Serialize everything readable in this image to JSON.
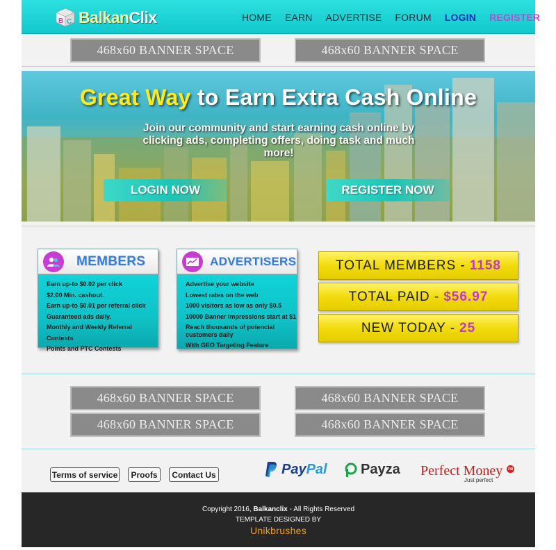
{
  "logo": {
    "part1": "Balkan",
    "part2": "Clix"
  },
  "nav": [
    {
      "label": "HOME"
    },
    {
      "label": "EARN"
    },
    {
      "label": "ADVERTISE"
    },
    {
      "label": "FORUM"
    },
    {
      "label": "LOGIN"
    },
    {
      "label": "REGISTER"
    }
  ],
  "banner_label": "468x60 BANNER SPACE",
  "hero": {
    "title_highlight": "Great Way",
    "title_rest": " to Earn Extra Cash Online",
    "subtitle": "Join our community and start earning cash online by clicking ads, completing offers, doing task and much more!",
    "login_button": "LOGIN NOW",
    "register_button": "REGISTER NOW"
  },
  "members_box": {
    "title": "MEMBERS",
    "items": [
      "Earn up-to $0.02 per click",
      "$2.00 Min. cashout.",
      "Earn up-to $0.01 per referral click",
      "Guaranteed ads daily.",
      "Monthly and Weekly Referral Contests",
      "Points and PTC Contests"
    ]
  },
  "advertisers_box": {
    "title": "ADVERTISERS",
    "items": [
      "Advertise your website",
      "Lowest rates on the web",
      "1000 visitors as low as only $0.5",
      "10000 Banner Impressions start at $1",
      "Reach thousands of potencial customers daily",
      "With GEO Targeting Feature"
    ]
  },
  "stats": [
    {
      "label": "TOTAL MEMBERS -",
      "value": "1158"
    },
    {
      "label": "TOTAL PAID -",
      "value": "$56.97"
    },
    {
      "label": "NEW TODAY -",
      "value": "25"
    }
  ],
  "footer_links": [
    "Terms of service",
    "Proofs",
    "Contact Us"
  ],
  "payments": {
    "paypal_1": "Pay",
    "paypal_2": "Pal",
    "payza": "Payza",
    "perfect_money": "Perfect Money",
    "perfect_money_tag": "Just perfect",
    "perfect_money_badge": "PM"
  },
  "bottom": {
    "copyright_prefix": "Copyright 2016, ",
    "copyright_brand": "Balkanclix",
    "copyright_suffix": " - All Rights Reserved",
    "designed_by": "TEMPLATE DESIGNED BY",
    "designer": "Unikbrushes"
  },
  "colors": {
    "header": "#12c8cc",
    "accent_purple": "#c63ed0",
    "stat_yellow": "#f2dc0c",
    "footer_bg": "#272727",
    "designer_orange": "#f0a020"
  }
}
